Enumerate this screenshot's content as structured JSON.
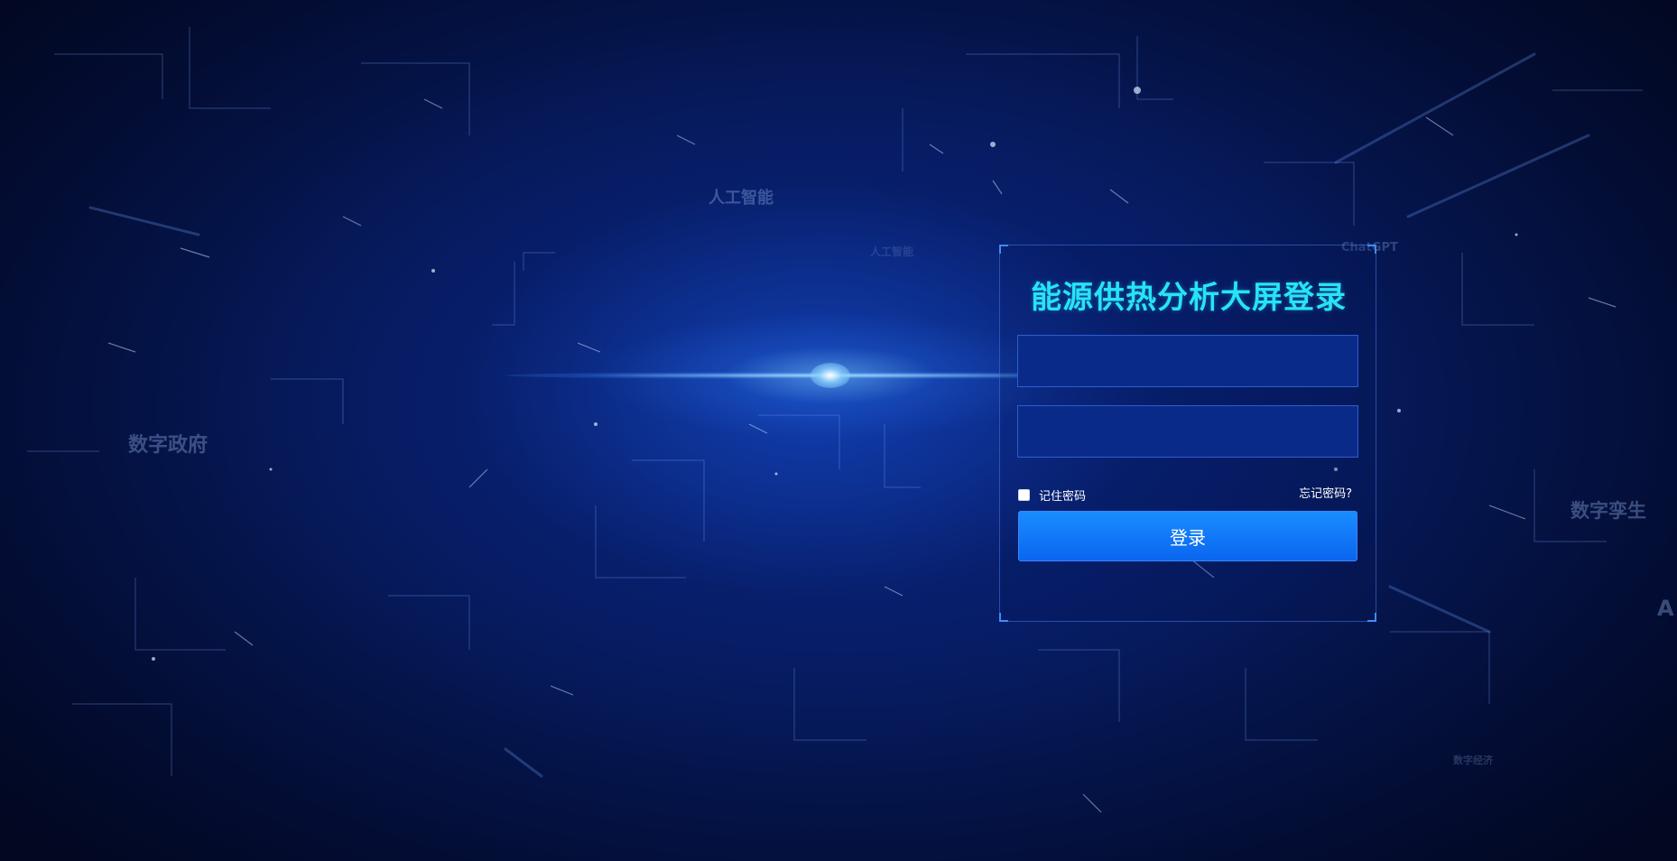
{
  "background": {
    "words": [
      "人工智能",
      "数字政府",
      "数字孪生",
      "ChatGPT",
      "数字经济",
      "人工智能",
      "A"
    ]
  },
  "login": {
    "title": "能源供热分析大屏登录",
    "username": {
      "value": "",
      "placeholder": ""
    },
    "password": {
      "value": "",
      "placeholder": ""
    },
    "remember_label": "记住密码",
    "remember_checked": false,
    "forgot_label": "忘记密码?",
    "submit_label": "登录"
  },
  "colors": {
    "title": "#27e3f7",
    "button": "#0a66f0",
    "field": "#0a2a8a",
    "background": "#040c2e"
  }
}
